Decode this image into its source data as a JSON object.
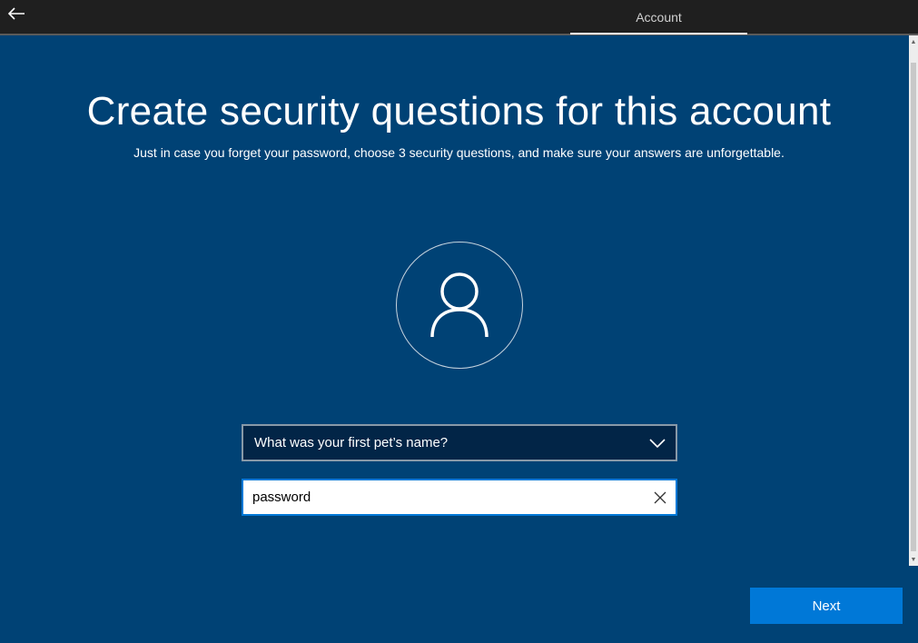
{
  "header": {
    "back_icon": "back-arrow-icon",
    "tab_label": "Account"
  },
  "main": {
    "title": "Create security questions for this account",
    "subtitle": "Just in case you forget your password, choose 3 security questions, and make sure your answers are unforgettable.",
    "avatar_icon": "user-icon"
  },
  "form": {
    "question_selected": "What was your first pet’s name?",
    "answer_value": "password",
    "chevron_icon": "chevron-down-icon",
    "clear_icon": "close-icon"
  },
  "footer": {
    "next_label": "Next"
  },
  "colors": {
    "background": "#004275",
    "topbar": "#1f1f1f",
    "accent": "#0078d7",
    "select_background": "#022547"
  }
}
